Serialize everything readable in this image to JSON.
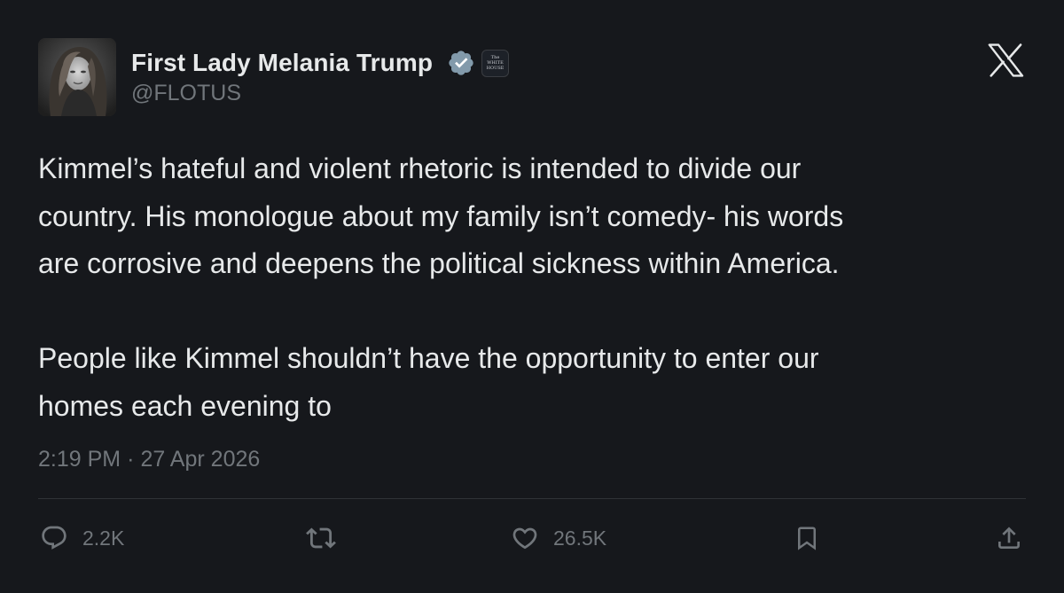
{
  "author": {
    "display_name": "First Lady Melania Trump",
    "handle": "@FLOTUS",
    "verified_badge_color": "#829aab",
    "affiliate_badge_text": "The WHITE HOUSE"
  },
  "tweet": {
    "text": "Kimmel’s hateful and violent rhetoric is intended to divide our\ncountry. His monologue about my family isn’t comedy- his words\nare corrosive and deepens the political sickness within America.\n\nPeople like Kimmel shouldn’t have the opportunity to enter our\nhomes each evening to",
    "time": "2:19 PM",
    "separator": "·",
    "date": "27 Apr 2026"
  },
  "actions": {
    "reply_count": "2.2K",
    "like_count": "26.5K"
  },
  "icons": {
    "brand": "x-logo-icon",
    "reply": "reply-icon",
    "repost": "repost-icon",
    "like": "heart-icon",
    "bookmark": "bookmark-icon",
    "share": "share-icon"
  },
  "colors": {
    "background": "#16181c",
    "text_primary": "#e7e9ea",
    "text_secondary": "#71767b",
    "divider": "#2f3336"
  }
}
